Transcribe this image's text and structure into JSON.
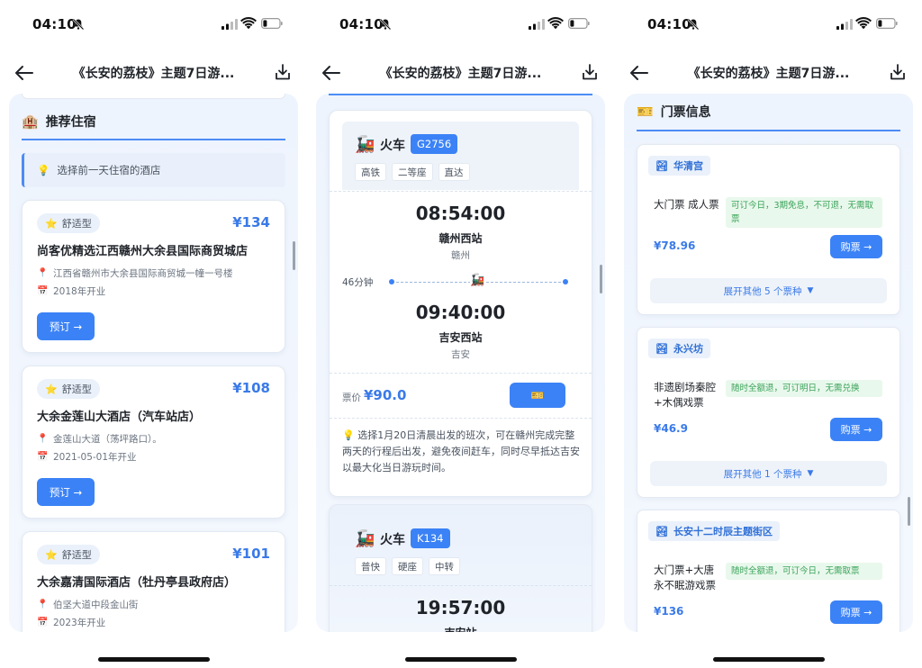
{
  "status_bar": {
    "time": "04:10"
  },
  "nav": {
    "title": "《长安的荔枝》主题7日游..."
  },
  "panel1": {
    "section_title": "推荐住宿",
    "tip": "选择前一天住宿的酒店",
    "hotels": [
      {
        "badge": "舒适型",
        "price": "¥134",
        "name": "尚客优精选江西赣州大余县国际商贸城店",
        "address": "江西省赣州市大余县国际商贸城一幢一号楼",
        "opened": "2018年开业",
        "book": "预订 →"
      },
      {
        "badge": "舒适型",
        "price": "¥108",
        "name": "大余金莲山大酒店（汽车站店）",
        "address": "金莲山大道（荡坪路口）。",
        "opened": "2021-05-01年开业",
        "book": "预订 →"
      },
      {
        "badge": "舒适型",
        "price": "¥101",
        "name": "大余嘉清国际酒店（牡丹亭县政府店）",
        "address": "伯坚大道中段金山街",
        "opened": "2023年开业"
      }
    ]
  },
  "panel2": {
    "trains": [
      {
        "kind": "火车",
        "code": "G2756",
        "tags": [
          "高铁",
          "二等座",
          "直达"
        ],
        "dep_time": "08:54:00",
        "dep_station": "赣州西站",
        "dep_city": "赣州",
        "duration": "46分钟",
        "arr_time": "09:40:00",
        "arr_station": "吉安西站",
        "arr_city": "吉安",
        "fare_label": "票价",
        "fare": "¥90.0",
        "advice": "选择1月20日清晨出发的班次，可在赣州完成完整两天的行程后出发，避免夜间赶车，同时尽早抵达吉安以最大化当日游玩时间。"
      },
      {
        "kind": "火车",
        "code": "K134",
        "tags": [
          "普快",
          "硬座",
          "中转"
        ],
        "dep_time": "19:57:00",
        "dep_station": "吉安站"
      }
    ]
  },
  "panel3": {
    "section_title": "门票信息",
    "sights": [
      {
        "name": "华清宫",
        "ticket": "大门票 成人票",
        "note": "可订今日，3期免息，不可退，无需取票",
        "price": "¥78.96",
        "buy": "购票 →",
        "more": "展开其他 5 个票种"
      },
      {
        "name": "永兴坊",
        "ticket": "非遗剧场秦腔+木偶戏票",
        "note": "随时全额退，可订明日，无需兑换",
        "price": "¥46.9",
        "buy": "购票 →",
        "more": "展开其他 1 个票种"
      },
      {
        "name": "长安十二时辰主题街区",
        "ticket": "大门票+大唐永不眠游戏票",
        "note": "随时全额退，可订今日，无需取票",
        "price": "¥136",
        "buy": "购票 →"
      }
    ]
  }
}
